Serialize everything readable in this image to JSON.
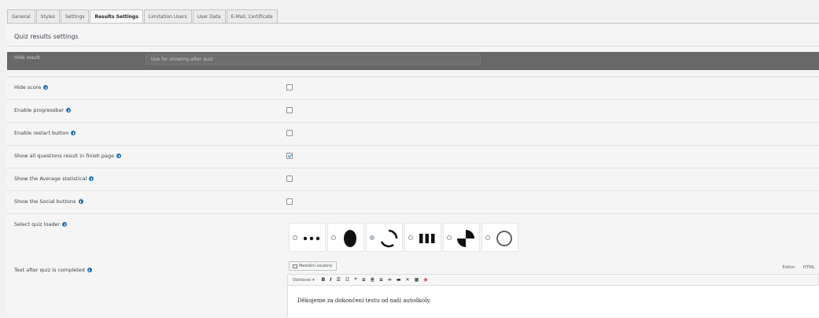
{
  "tabs": [
    "General",
    "Styles",
    "Settings",
    "Results Settings",
    "Limitation Users",
    "User Data",
    "E-Mail, Certificate"
  ],
  "active_tab_index": 3,
  "panel_title": "Quiz results settings",
  "hide_result": {
    "label": "Hide result",
    "placeholder": "Use for showing after quiz"
  },
  "rows": [
    {
      "label": "Hide score",
      "checked": false
    },
    {
      "label": "Enable progressbar",
      "checked": false
    },
    {
      "label": "Enable restart button",
      "checked": false
    },
    {
      "label": "Show all questions result in finish page",
      "checked": true
    },
    {
      "label": "Show the Average statistical",
      "checked": false
    },
    {
      "label": "Show the Social buttons",
      "checked": false
    }
  ],
  "loader": {
    "label": "Select quiz loader",
    "options": [
      "dots-loader-icon",
      "ellipse-loader-icon",
      "arc-spinner-loader-icon",
      "bars-loader-icon",
      "quadrant-loader-icon",
      "ring-loader-icon"
    ],
    "selected_index": 2
  },
  "text_after": {
    "label": "Text after quiz is completed",
    "media_button": "Mediální soubory",
    "editor_tab_visual": "Editor",
    "editor_tab_html": "HTML",
    "format_select": "Odstavec",
    "content": "Děkujeme za dokončení testu od naší autoškoly."
  },
  "colors": {
    "accent": "#2271b1",
    "hide_row_bg": "#686868",
    "panel_bg": "#f5f5f5"
  }
}
